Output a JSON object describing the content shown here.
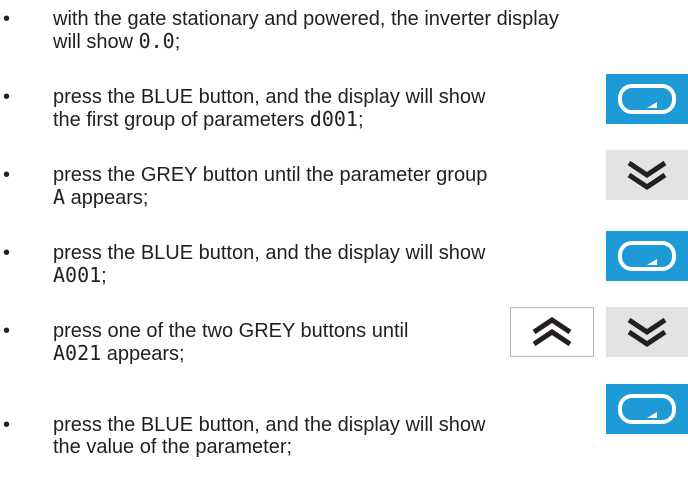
{
  "steps": [
    {
      "bullet": "•",
      "pre": "with the gate stationary and powered, the inverter display",
      "line2_pre": "will show ",
      "code": "0.0",
      "post": ";"
    },
    {
      "bullet": "•",
      "pre": "press the BLUE button, and the display will show",
      "line2_pre": "the first group of parameters ",
      "code": "d001",
      "post": ";"
    },
    {
      "bullet": "•",
      "pre": "press the GREY button until the parameter group",
      "code": "A",
      "post": " appears;"
    },
    {
      "bullet": "•",
      "pre": "press the BLUE button, and the display will show",
      "code": "A001",
      "post": ";"
    },
    {
      "bullet": "•",
      "pre": "press one of the two GREY buttons until",
      "code": "A021",
      "post": " appears;"
    },
    {
      "bullet": "•",
      "pre": "press the BLUE button, and the display will show",
      "line2_pre": "the value of the parameter;"
    }
  ],
  "buttons": {
    "blue_color": "#1e9ad6",
    "grey_color": "#e3e3e3",
    "enter_icon": "enter-return-icon",
    "down_icon": "double-chevron-down-icon",
    "up_icon": "double-chevron-up-icon"
  }
}
